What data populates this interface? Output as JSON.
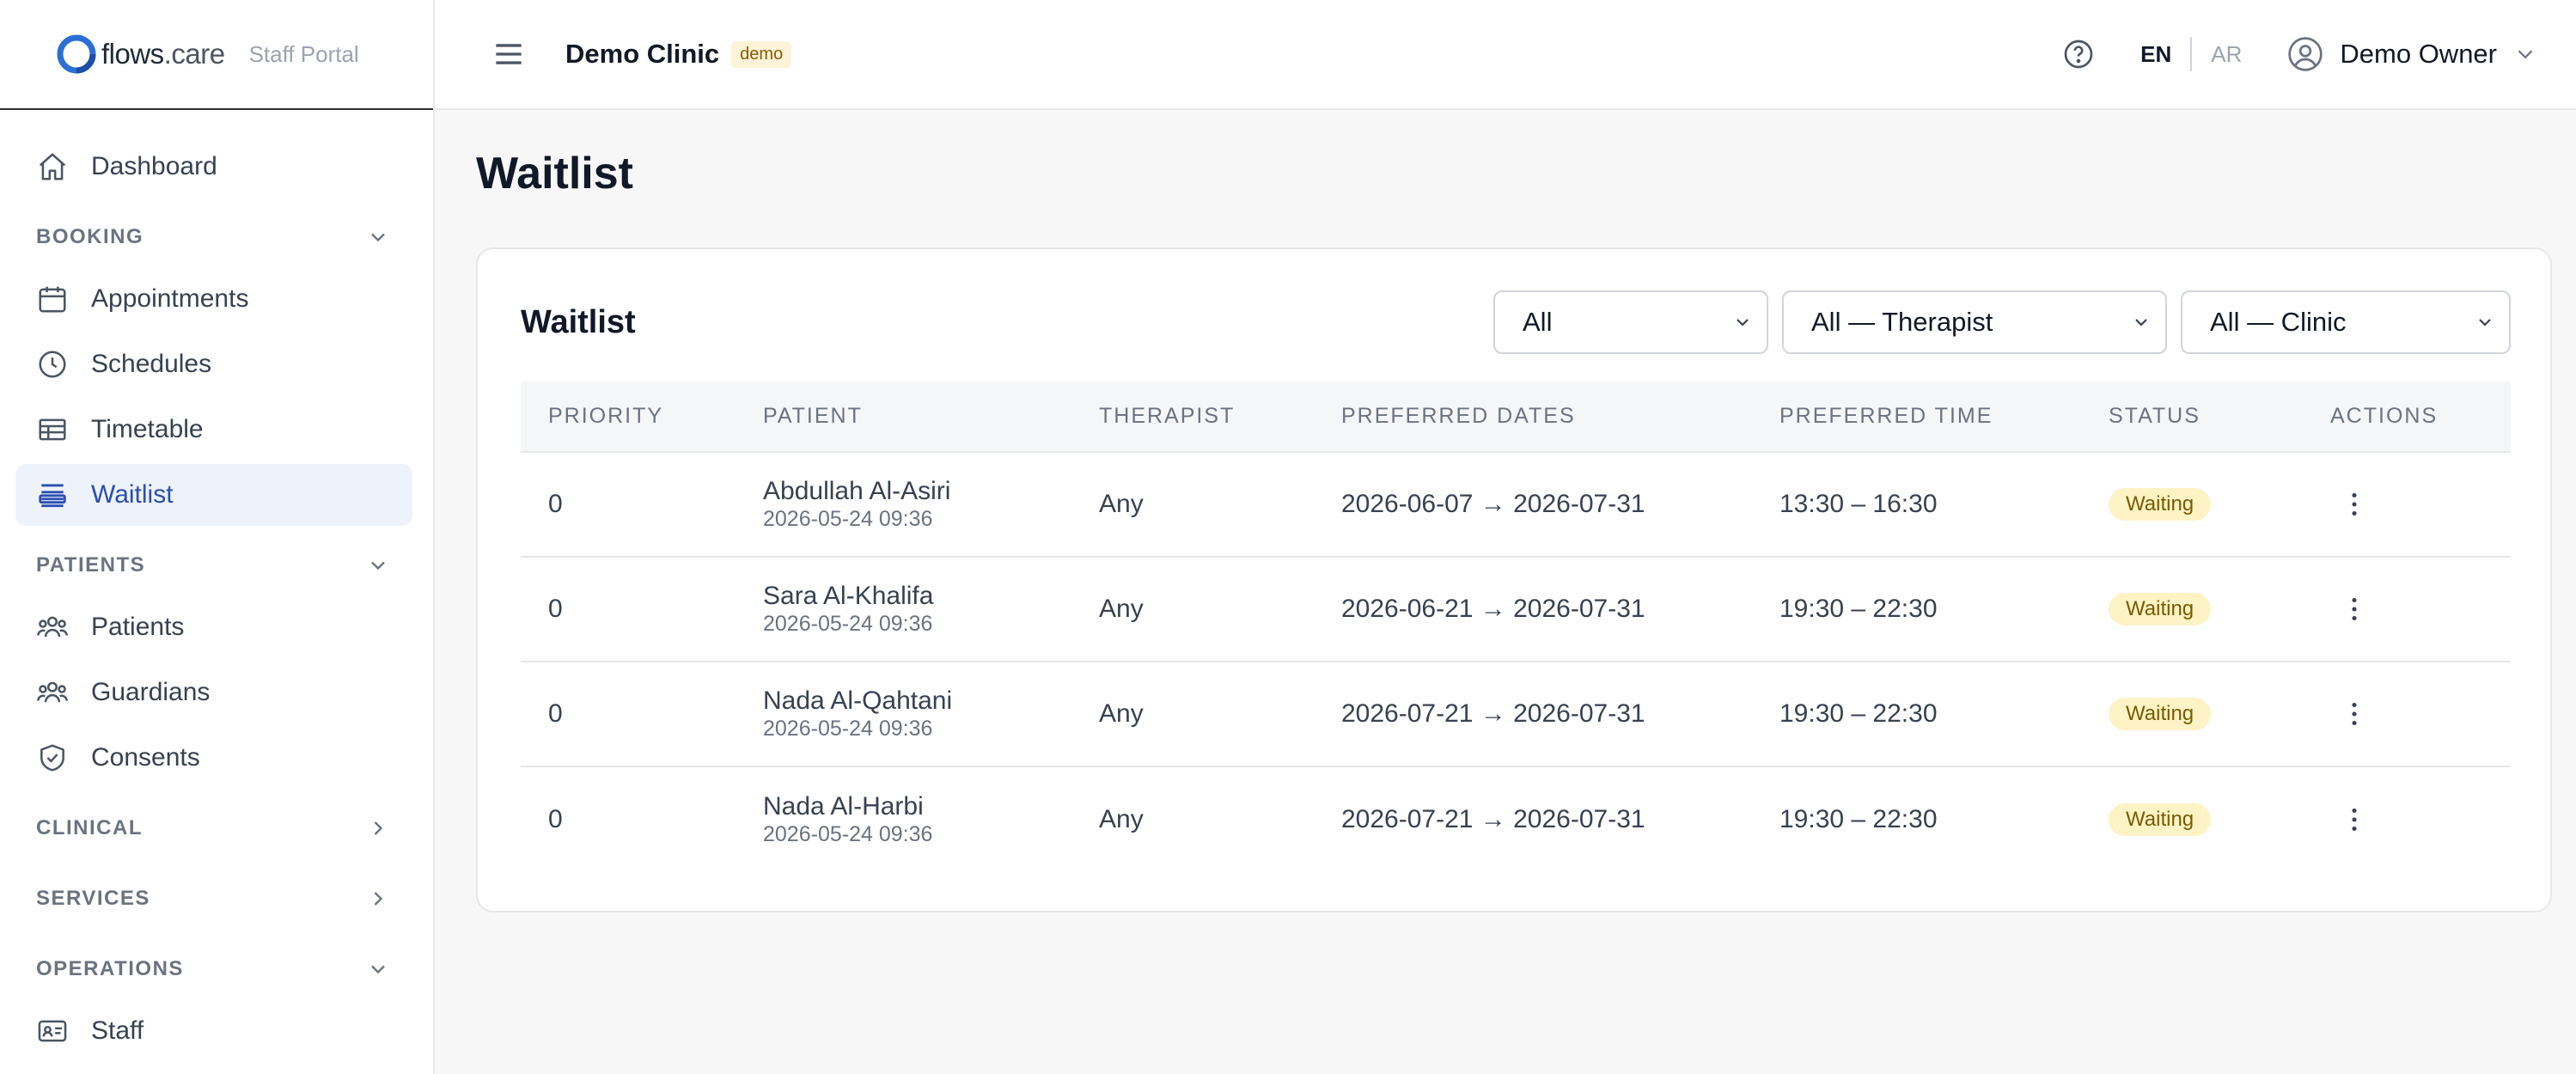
{
  "brand": {
    "name_main": "flows",
    "name_suffix": ".care",
    "subtitle": "Staff Portal"
  },
  "sidebar": {
    "dashboard": "Dashboard",
    "sections": {
      "booking": "BOOKING",
      "patients": "PATIENTS",
      "clinical": "CLINICAL",
      "services": "SERVICES",
      "operations": "OPERATIONS"
    },
    "items": {
      "appointments": "Appointments",
      "schedules": "Schedules",
      "timetable": "Timetable",
      "waitlist": "Waitlist",
      "patients": "Patients",
      "guardians": "Guardians",
      "consents": "Consents",
      "staff": "Staff"
    }
  },
  "topbar": {
    "clinic_name": "Demo Clinic",
    "clinic_badge": "demo",
    "lang_en": "EN",
    "lang_ar": "AR",
    "user_name": "Demo Owner"
  },
  "page": {
    "title": "Waitlist"
  },
  "card": {
    "title": "Waitlist",
    "filters": {
      "status": "All",
      "therapist": "All — Therapist",
      "clinic": "All — Clinic"
    },
    "columns": [
      "PRIORITY",
      "PATIENT",
      "THERAPIST",
      "PREFERRED DATES",
      "PREFERRED TIME",
      "STATUS",
      "ACTIONS"
    ],
    "rows": [
      {
        "priority": "0",
        "patient": "Abdullah Al-Asiri",
        "created": "2026-05-24 09:36",
        "therapist": "Any",
        "dates": "2026-06-07 → 2026-07-31",
        "time": "13:30 – 16:30",
        "status": "Waiting"
      },
      {
        "priority": "0",
        "patient": "Sara Al-Khalifa",
        "created": "2026-05-24 09:36",
        "therapist": "Any",
        "dates": "2026-06-21 → 2026-07-31",
        "time": "19:30 – 22:30",
        "status": "Waiting"
      },
      {
        "priority": "0",
        "patient": "Nada Al-Qahtani",
        "created": "2026-05-24 09:36",
        "therapist": "Any",
        "dates": "2026-07-21 → 2026-07-31",
        "time": "19:30 – 22:30",
        "status": "Waiting"
      },
      {
        "priority": "0",
        "patient": "Nada Al-Harbi",
        "created": "2026-05-24 09:36",
        "therapist": "Any",
        "dates": "2026-07-21 → 2026-07-31",
        "time": "19:30 – 22:30",
        "status": "Waiting"
      }
    ]
  },
  "colors": {
    "accent": "#2b4eb0",
    "active_bg": "#eef2fb",
    "badge_bg": "#fdf3c4",
    "badge_text": "#7a5a00"
  }
}
